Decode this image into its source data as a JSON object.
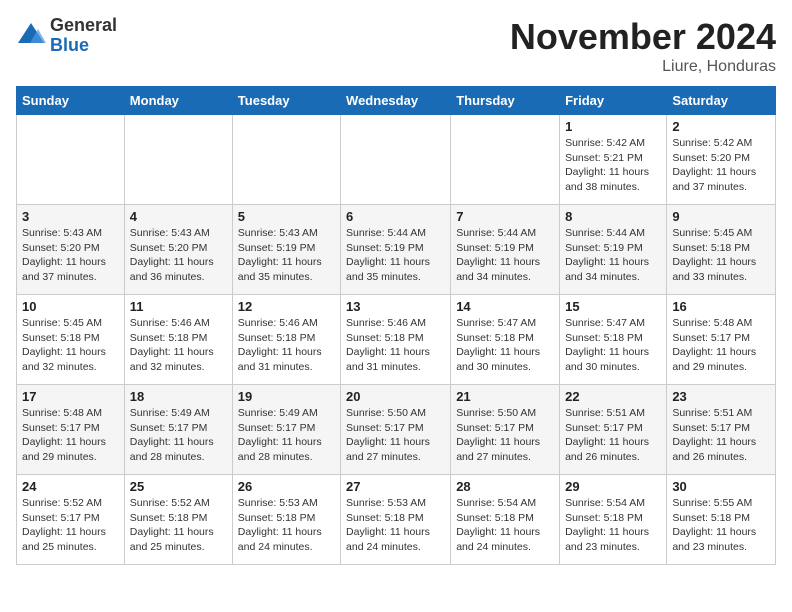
{
  "header": {
    "logo_general": "General",
    "logo_blue": "Blue",
    "month_title": "November 2024",
    "subtitle": "Liure, Honduras"
  },
  "days_of_week": [
    "Sunday",
    "Monday",
    "Tuesday",
    "Wednesday",
    "Thursday",
    "Friday",
    "Saturday"
  ],
  "weeks": [
    [
      {
        "day": "",
        "info": ""
      },
      {
        "day": "",
        "info": ""
      },
      {
        "day": "",
        "info": ""
      },
      {
        "day": "",
        "info": ""
      },
      {
        "day": "",
        "info": ""
      },
      {
        "day": "1",
        "info": "Sunrise: 5:42 AM\nSunset: 5:21 PM\nDaylight: 11 hours and 38 minutes."
      },
      {
        "day": "2",
        "info": "Sunrise: 5:42 AM\nSunset: 5:20 PM\nDaylight: 11 hours and 37 minutes."
      }
    ],
    [
      {
        "day": "3",
        "info": "Sunrise: 5:43 AM\nSunset: 5:20 PM\nDaylight: 11 hours and 37 minutes."
      },
      {
        "day": "4",
        "info": "Sunrise: 5:43 AM\nSunset: 5:20 PM\nDaylight: 11 hours and 36 minutes."
      },
      {
        "day": "5",
        "info": "Sunrise: 5:43 AM\nSunset: 5:19 PM\nDaylight: 11 hours and 35 minutes."
      },
      {
        "day": "6",
        "info": "Sunrise: 5:44 AM\nSunset: 5:19 PM\nDaylight: 11 hours and 35 minutes."
      },
      {
        "day": "7",
        "info": "Sunrise: 5:44 AM\nSunset: 5:19 PM\nDaylight: 11 hours and 34 minutes."
      },
      {
        "day": "8",
        "info": "Sunrise: 5:44 AM\nSunset: 5:19 PM\nDaylight: 11 hours and 34 minutes."
      },
      {
        "day": "9",
        "info": "Sunrise: 5:45 AM\nSunset: 5:18 PM\nDaylight: 11 hours and 33 minutes."
      }
    ],
    [
      {
        "day": "10",
        "info": "Sunrise: 5:45 AM\nSunset: 5:18 PM\nDaylight: 11 hours and 32 minutes."
      },
      {
        "day": "11",
        "info": "Sunrise: 5:46 AM\nSunset: 5:18 PM\nDaylight: 11 hours and 32 minutes."
      },
      {
        "day": "12",
        "info": "Sunrise: 5:46 AM\nSunset: 5:18 PM\nDaylight: 11 hours and 31 minutes."
      },
      {
        "day": "13",
        "info": "Sunrise: 5:46 AM\nSunset: 5:18 PM\nDaylight: 11 hours and 31 minutes."
      },
      {
        "day": "14",
        "info": "Sunrise: 5:47 AM\nSunset: 5:18 PM\nDaylight: 11 hours and 30 minutes."
      },
      {
        "day": "15",
        "info": "Sunrise: 5:47 AM\nSunset: 5:18 PM\nDaylight: 11 hours and 30 minutes."
      },
      {
        "day": "16",
        "info": "Sunrise: 5:48 AM\nSunset: 5:17 PM\nDaylight: 11 hours and 29 minutes."
      }
    ],
    [
      {
        "day": "17",
        "info": "Sunrise: 5:48 AM\nSunset: 5:17 PM\nDaylight: 11 hours and 29 minutes."
      },
      {
        "day": "18",
        "info": "Sunrise: 5:49 AM\nSunset: 5:17 PM\nDaylight: 11 hours and 28 minutes."
      },
      {
        "day": "19",
        "info": "Sunrise: 5:49 AM\nSunset: 5:17 PM\nDaylight: 11 hours and 28 minutes."
      },
      {
        "day": "20",
        "info": "Sunrise: 5:50 AM\nSunset: 5:17 PM\nDaylight: 11 hours and 27 minutes."
      },
      {
        "day": "21",
        "info": "Sunrise: 5:50 AM\nSunset: 5:17 PM\nDaylight: 11 hours and 27 minutes."
      },
      {
        "day": "22",
        "info": "Sunrise: 5:51 AM\nSunset: 5:17 PM\nDaylight: 11 hours and 26 minutes."
      },
      {
        "day": "23",
        "info": "Sunrise: 5:51 AM\nSunset: 5:17 PM\nDaylight: 11 hours and 26 minutes."
      }
    ],
    [
      {
        "day": "24",
        "info": "Sunrise: 5:52 AM\nSunset: 5:17 PM\nDaylight: 11 hours and 25 minutes."
      },
      {
        "day": "25",
        "info": "Sunrise: 5:52 AM\nSunset: 5:18 PM\nDaylight: 11 hours and 25 minutes."
      },
      {
        "day": "26",
        "info": "Sunrise: 5:53 AM\nSunset: 5:18 PM\nDaylight: 11 hours and 24 minutes."
      },
      {
        "day": "27",
        "info": "Sunrise: 5:53 AM\nSunset: 5:18 PM\nDaylight: 11 hours and 24 minutes."
      },
      {
        "day": "28",
        "info": "Sunrise: 5:54 AM\nSunset: 5:18 PM\nDaylight: 11 hours and 24 minutes."
      },
      {
        "day": "29",
        "info": "Sunrise: 5:54 AM\nSunset: 5:18 PM\nDaylight: 11 hours and 23 minutes."
      },
      {
        "day": "30",
        "info": "Sunrise: 5:55 AM\nSunset: 5:18 PM\nDaylight: 11 hours and 23 minutes."
      }
    ]
  ]
}
